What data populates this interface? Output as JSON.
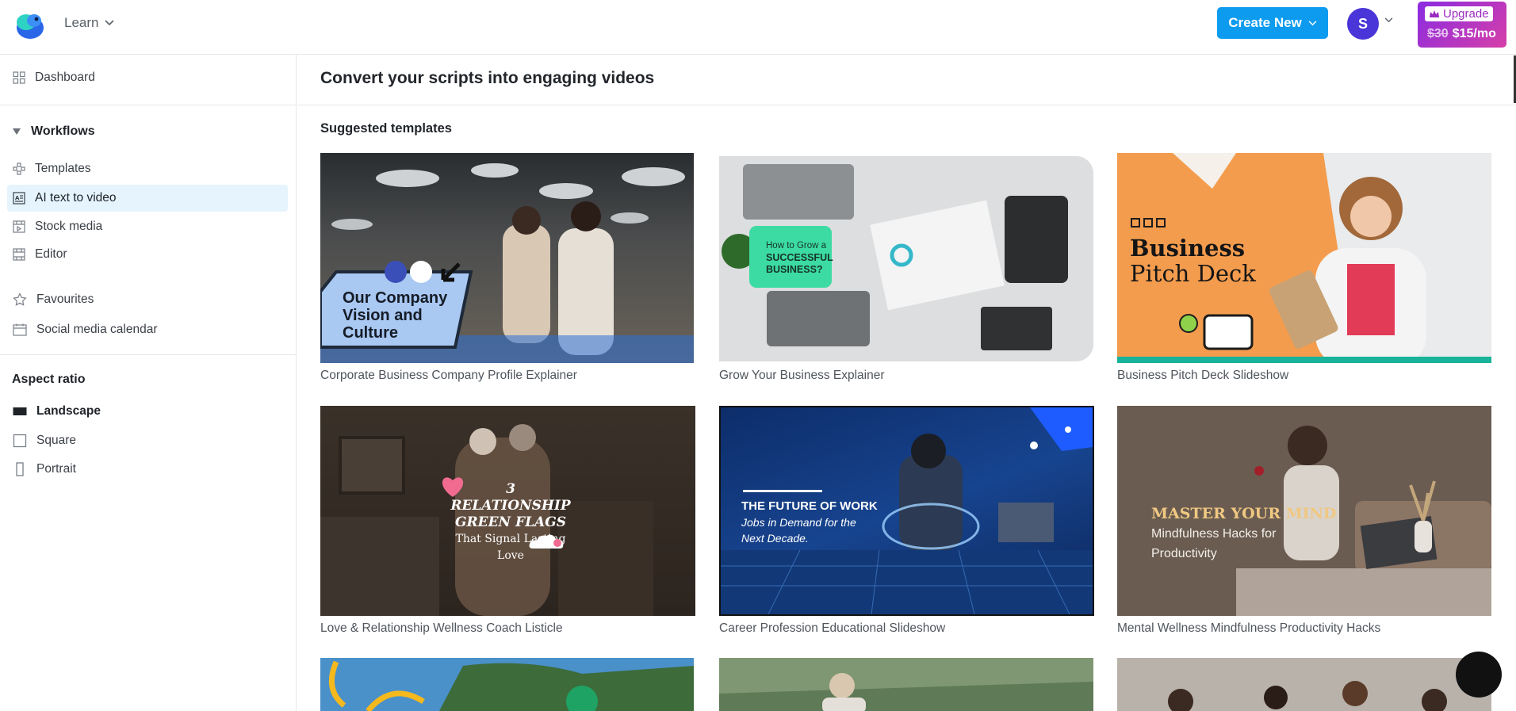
{
  "header": {
    "learn_label": "Learn",
    "create_label": "Create New",
    "avatar_initial": "S",
    "upgrade_label": "Upgrade",
    "price_old": "$30",
    "price_new": "$15/mo"
  },
  "sidebar": {
    "dashboard": "Dashboard",
    "workflows": "Workflows",
    "items": [
      {
        "label": "Templates"
      },
      {
        "label": "AI text to video"
      },
      {
        "label": "Stock media"
      },
      {
        "label": "Editor"
      }
    ],
    "favourites": "Favourites",
    "calendar": "Social media calendar",
    "aspect_title": "Aspect ratio",
    "aspects": [
      {
        "label": "Landscape"
      },
      {
        "label": "Square"
      },
      {
        "label": "Portrait"
      }
    ]
  },
  "main": {
    "title": "Convert your scripts into engaging videos",
    "section": "Suggested templates",
    "templates": [
      {
        "label": "Corporate Business Company Profile Explainer",
        "overlay": [
          "Our Company",
          "Vision and",
          "Culture"
        ]
      },
      {
        "label": "Grow Your Business Explainer",
        "overlay": [
          "How to Grow a",
          "SUCCESSFUL",
          "BUSINESS?"
        ]
      },
      {
        "label": "Business Pitch Deck Slideshow",
        "overlay": [
          "Business",
          "Pitch Deck"
        ]
      },
      {
        "label": "Love & Relationship Wellness Coach Listicle",
        "overlay": [
          "3 RELATIONSHIP",
          "GREEN FLAGS",
          "That Signal Lasting Love"
        ]
      },
      {
        "label": "Career Profession Educational Slideshow",
        "overlay": [
          "THE FUTURE OF WORK",
          "Jobs in Demand for the",
          "Next Decade."
        ]
      },
      {
        "label": "Mental Wellness Mindfulness Productivity Hacks",
        "overlay": [
          "MASTER YOUR MIND",
          "Mindfulness Hacks for",
          "Productivity"
        ]
      }
    ]
  },
  "colors": {
    "accent": "#0d9bf0",
    "avatar": "#4a35d8",
    "active_bg": "#e5f4fd"
  }
}
